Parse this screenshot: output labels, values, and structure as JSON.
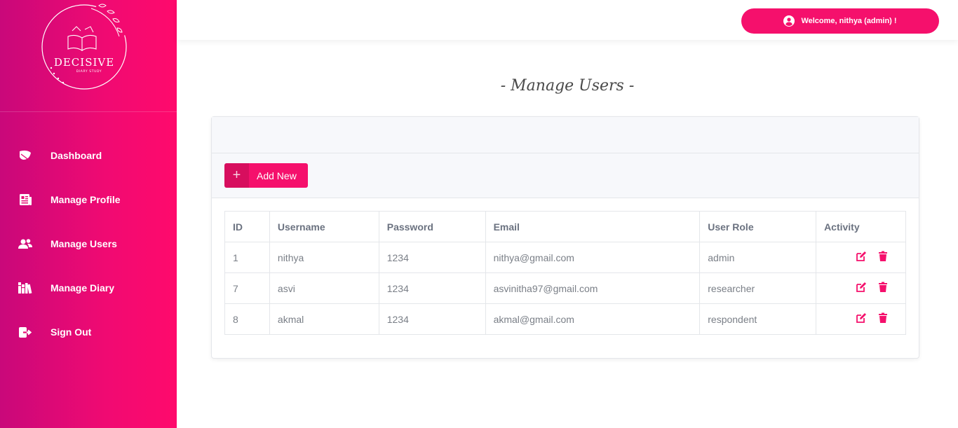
{
  "sidebar": {
    "logo": {
      "text": "DECISIVE",
      "subtext": "DIARY STUDY"
    },
    "items": [
      {
        "label": "Dashboard",
        "icon": "leaf-icon"
      },
      {
        "label": "Manage Profile",
        "icon": "newspaper-icon"
      },
      {
        "label": "Manage Users",
        "icon": "users-icon"
      },
      {
        "label": "Manage Diary",
        "icon": "books-icon"
      },
      {
        "label": "Sign Out",
        "icon": "sign-out-icon"
      }
    ]
  },
  "header": {
    "welcome": "Welcome, nithya (admin) !"
  },
  "main": {
    "title": "- Manage Users -",
    "add_button": "Add New",
    "table": {
      "columns": [
        "ID",
        "Username",
        "Password",
        "Email",
        "User Role",
        "Activity"
      ],
      "rows": [
        {
          "id": "1",
          "username": "nithya",
          "password": "1234",
          "email": "nithya@gmail.com",
          "role": "admin"
        },
        {
          "id": "7",
          "username": "asvi",
          "password": "1234",
          "email": "asvinitha97@gmail.com",
          "role": "researcher"
        },
        {
          "id": "8",
          "username": "akmal",
          "password": "1234",
          "email": "akmal@gmail.com",
          "role": "respondent"
        }
      ]
    }
  },
  "colors": {
    "accent": "#f5106c",
    "sidebar_start": "#c9087a",
    "sidebar_end": "#ff0a6c"
  }
}
